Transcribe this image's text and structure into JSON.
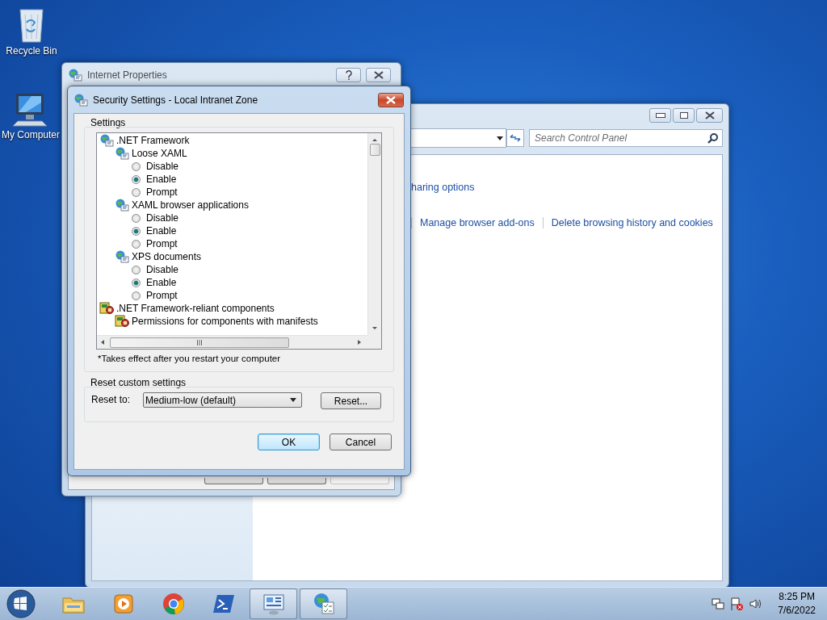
{
  "desktop_icons": [
    {
      "label": "Recycle Bin",
      "kind": "bin"
    },
    {
      "label": "My Computer",
      "kind": "computer"
    }
  ],
  "control_panel": {
    "search": {
      "placeholder": "Search Control Panel"
    },
    "text": "haring options",
    "links": [
      "Manage browser add-ons",
      "Delete browsing history and cookies"
    ]
  },
  "internet_properties": {
    "title": "Internet Properties",
    "buttons": [
      {
        "disabled": false
      },
      {
        "disabled": false
      },
      {
        "disabled": true
      }
    ]
  },
  "security_dialog": {
    "title": "Security Settings - Local Intranet Zone",
    "settings_label": "Settings",
    "tree": [
      {
        "label": ".NET Framework",
        "kind": "category",
        "children": [
          {
            "label": "Loose XAML",
            "kind": "setting",
            "children": [
              {
                "label": "Disable",
                "kind": "option",
                "selected": false
              },
              {
                "label": "Enable",
                "kind": "option",
                "selected": true
              },
              {
                "label": "Prompt",
                "kind": "option",
                "selected": false
              }
            ]
          },
          {
            "label": "XAML browser applications",
            "kind": "setting",
            "children": [
              {
                "label": "Disable",
                "kind": "option",
                "selected": false
              },
              {
                "label": "Enable",
                "kind": "option",
                "selected": true
              },
              {
                "label": "Prompt",
                "kind": "option",
                "selected": false
              }
            ]
          },
          {
            "label": "XPS documents",
            "kind": "setting",
            "children": [
              {
                "label": "Disable",
                "kind": "option",
                "selected": false
              },
              {
                "label": "Enable",
                "kind": "option",
                "selected": true
              },
              {
                "label": "Prompt",
                "kind": "option",
                "selected": false
              }
            ]
          }
        ]
      },
      {
        "label": ".NET Framework-reliant components",
        "kind": "category",
        "children": [
          {
            "label": "Permissions for components with manifests",
            "kind": "setting"
          }
        ]
      }
    ],
    "note": "*Takes effect after you restart your computer",
    "reset_group": "Reset custom settings",
    "reset_label": "Reset to:",
    "reset_value": "Medium-low (default)",
    "reset_button": "Reset...",
    "buttons": [
      {
        "label": "OK",
        "default": true
      },
      {
        "label": "Cancel",
        "default": false
      }
    ]
  },
  "taskbar": {
    "items": [
      {
        "kind": "explorer",
        "active": false
      },
      {
        "kind": "media",
        "active": false
      },
      {
        "kind": "browser",
        "active": false
      },
      {
        "kind": "shell",
        "active": false
      },
      {
        "kind": "control-panel",
        "active": true
      },
      {
        "kind": "internet-options",
        "active": true
      }
    ],
    "time": "8:25 PM",
    "date": "7/6/2022"
  }
}
